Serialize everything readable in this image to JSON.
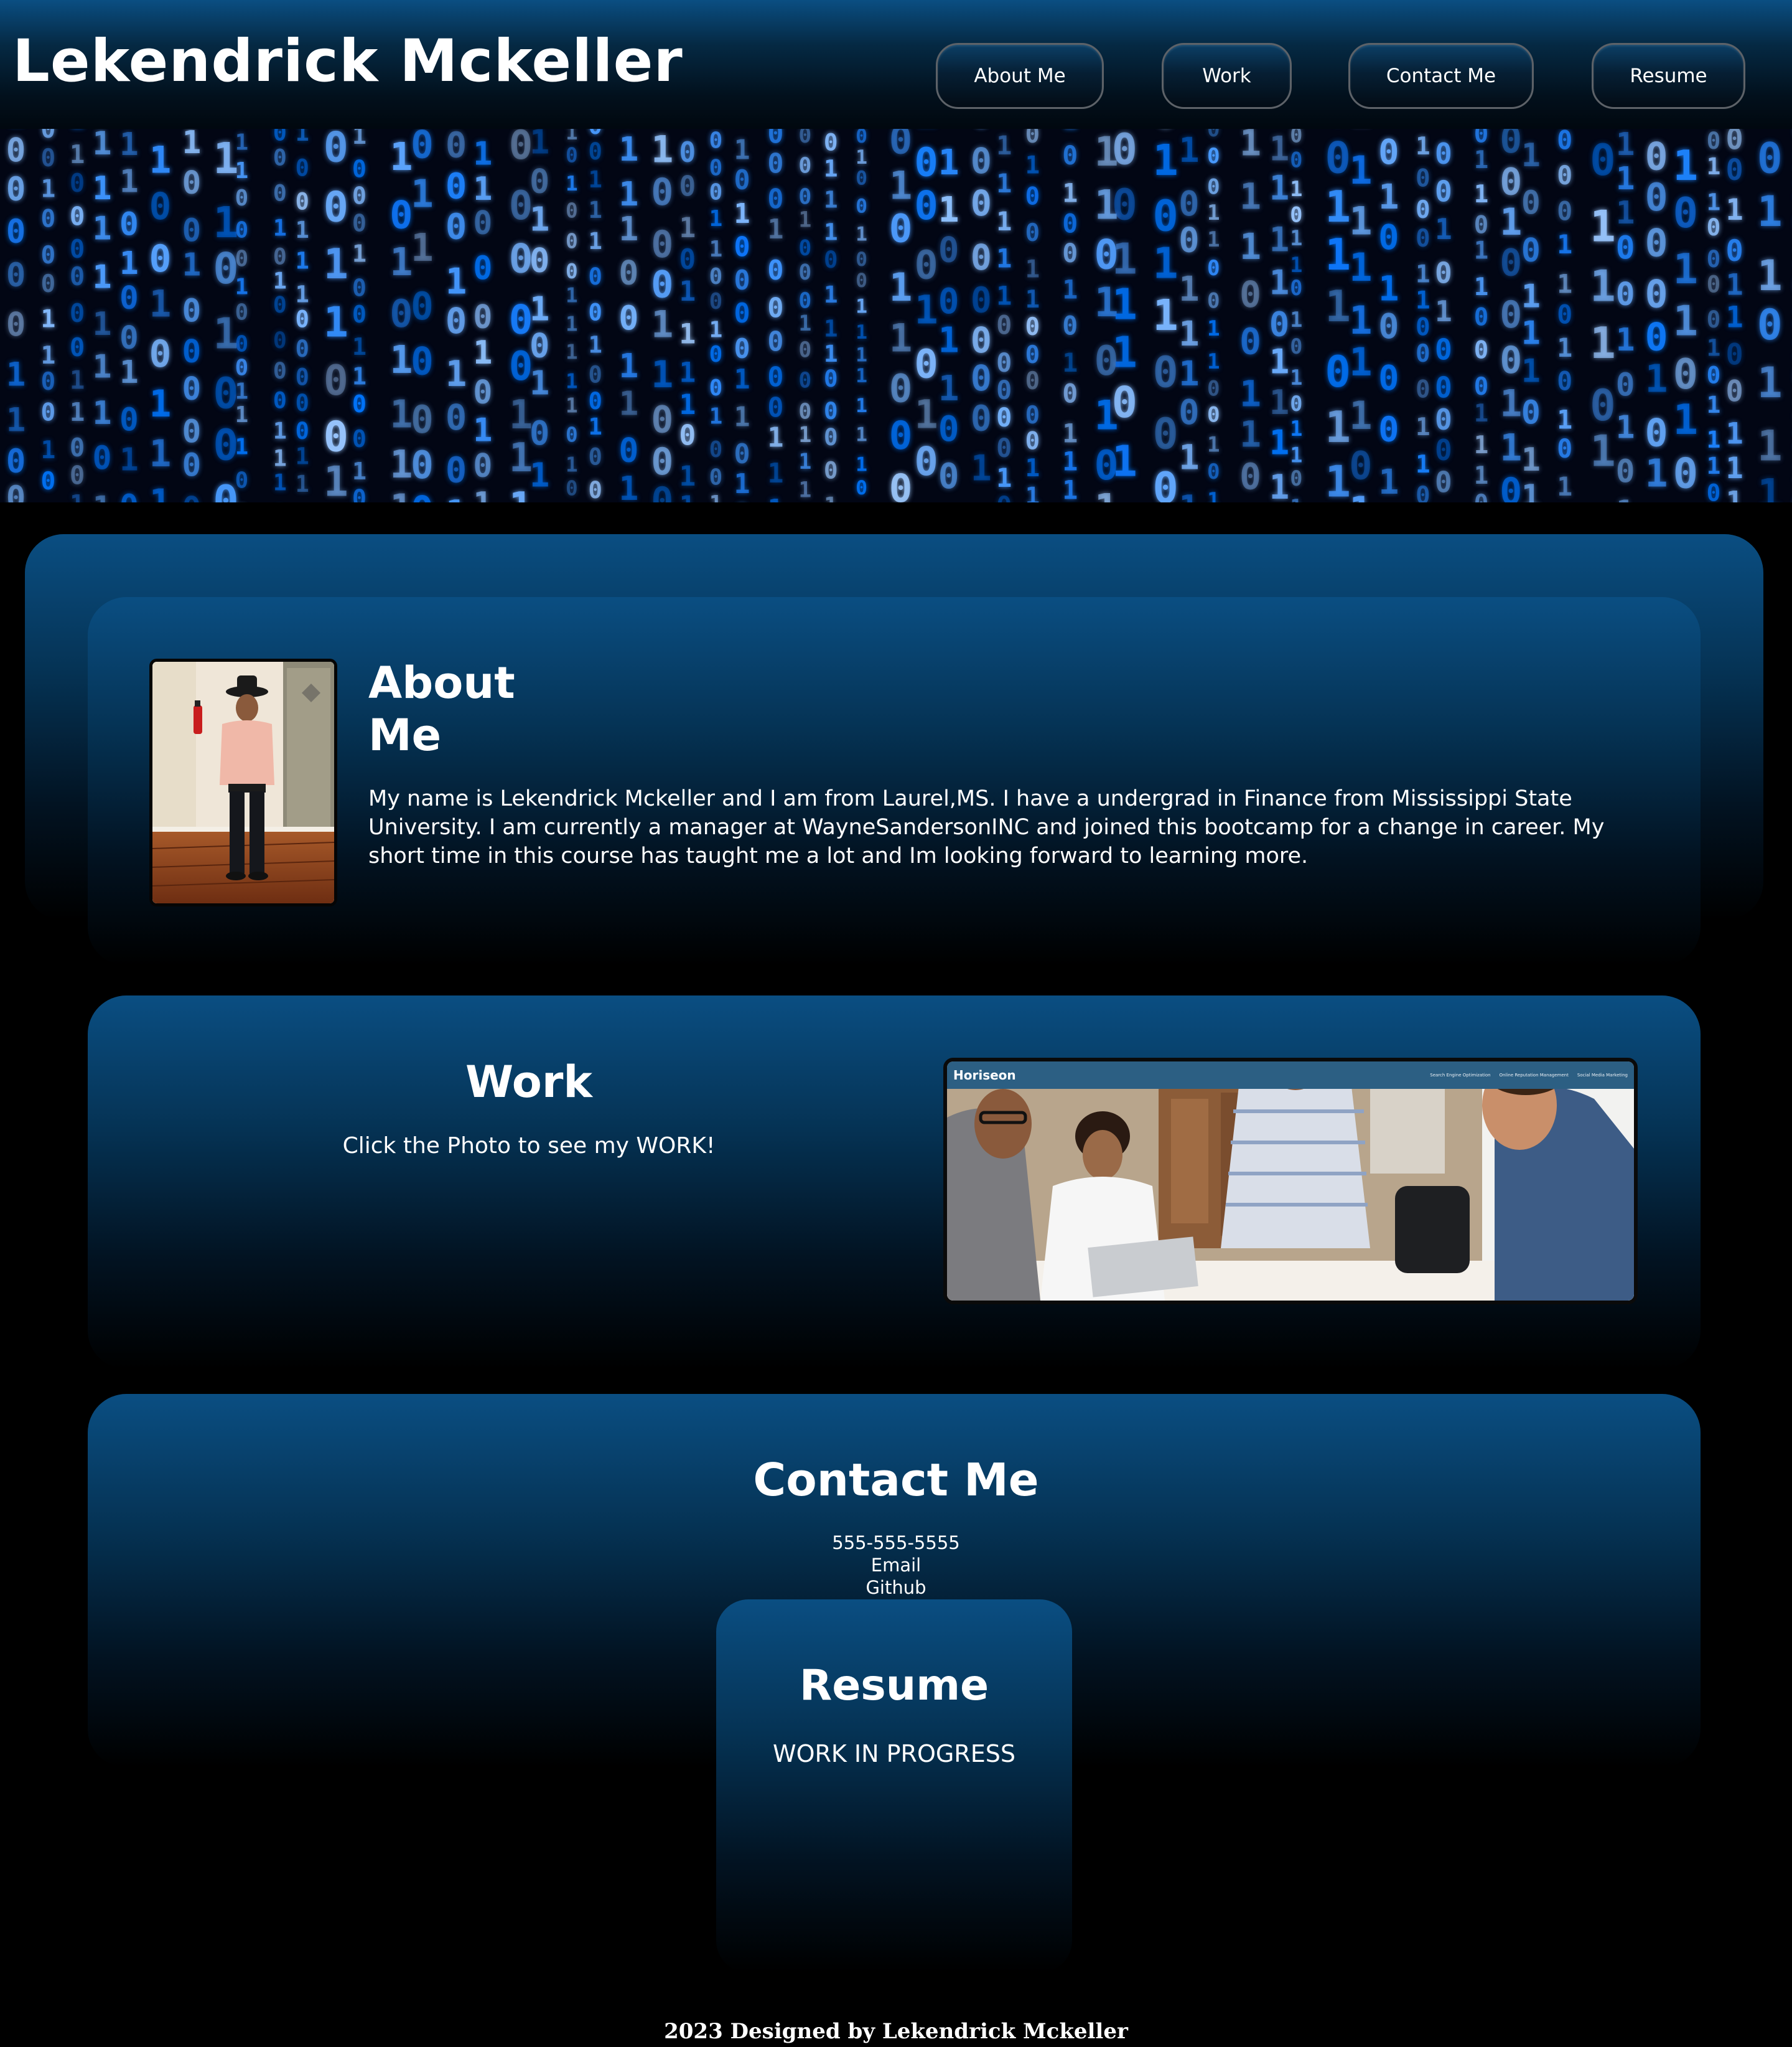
{
  "header": {
    "title": "Lekendrick Mckeller",
    "nav": [
      "About Me",
      "Work",
      "Contact Me",
      "Resume"
    ]
  },
  "about": {
    "title": "About Me",
    "text": "My name is Lekendrick Mckeller and I am from Laurel,MS. I have a undergrad in Finance from Mississippi State University. I am currently a manager at WayneSandersonINC and joined this bootcamp for a change in career. My short time in this course has taught me a lot and Im looking forward to learning more."
  },
  "work": {
    "title": "Work",
    "text": "Click the Photo to see my WORK!",
    "preview": {
      "brand": "Horiseon",
      "links": [
        "Search Engine Optimization",
        "Online Reputation Management",
        "Social Media Marketing"
      ]
    }
  },
  "contact": {
    "title": "Contact Me",
    "phone": "555-555-5555",
    "email": "Email",
    "github": "Github"
  },
  "resume": {
    "title": "Resume",
    "text": "WORK IN PROGRESS"
  },
  "footer": "2023 Designed by Lekendrick Mckeller",
  "colors": {
    "accent": "#0a4e82",
    "background": "#000000",
    "hero_glow": "#2f8dff"
  }
}
